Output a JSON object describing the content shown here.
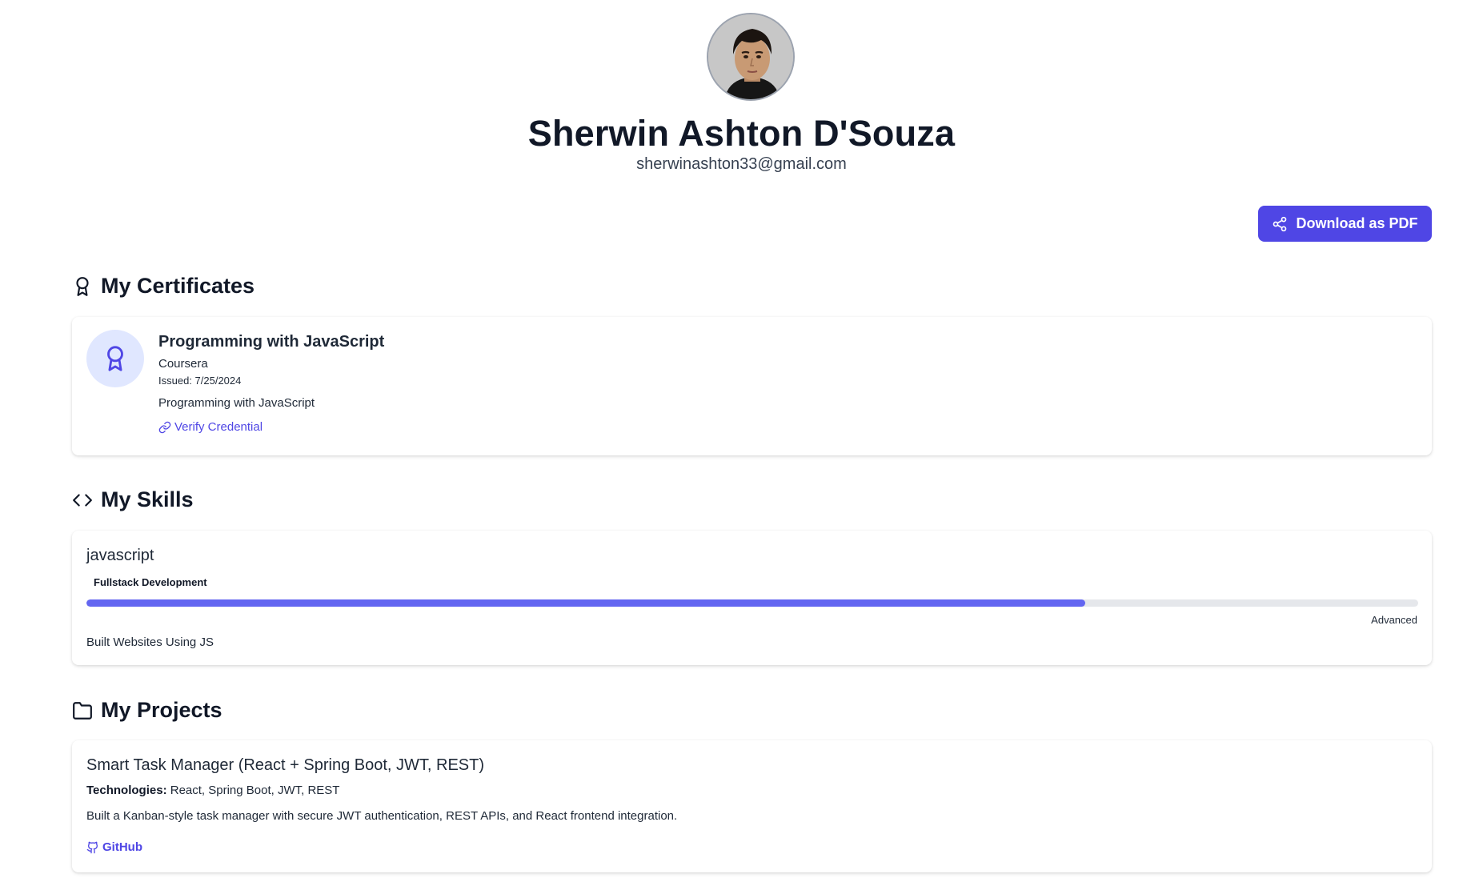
{
  "profile": {
    "name": "Sherwin Ashton D'Souza",
    "email": "sherwinashton33@gmail.com"
  },
  "actions": {
    "download_label": "Download as PDF",
    "download_icon": "share-icon",
    "accent_color": "#4f46e5"
  },
  "certificates": {
    "heading": "My Certificates",
    "icon": "award-icon",
    "items": [
      {
        "title": "Programming with JavaScript",
        "issuer": "Coursera",
        "issued": "Issued: 7/25/2024",
        "description": "Programming with JavaScript",
        "link_label": "Verify Credential"
      }
    ]
  },
  "skills": {
    "heading": "My Skills",
    "icon": "code-icon",
    "items": [
      {
        "name": "javascript",
        "category": "Fullstack Development",
        "level": "Advanced",
        "progress_percent": 75,
        "description": "Built Websites Using JS"
      }
    ]
  },
  "projects": {
    "heading": "My Projects",
    "icon": "folder-icon",
    "items": [
      {
        "title": "Smart Task Manager (React + Spring Boot, JWT, REST)",
        "tech_label": "Technologies:",
        "tech_value": "React, Spring Boot, JWT, REST",
        "description": "Built a Kanban-style task manager with secure JWT authentication, REST APIs, and React frontend integration.",
        "link_label": "GitHub"
      }
    ]
  }
}
